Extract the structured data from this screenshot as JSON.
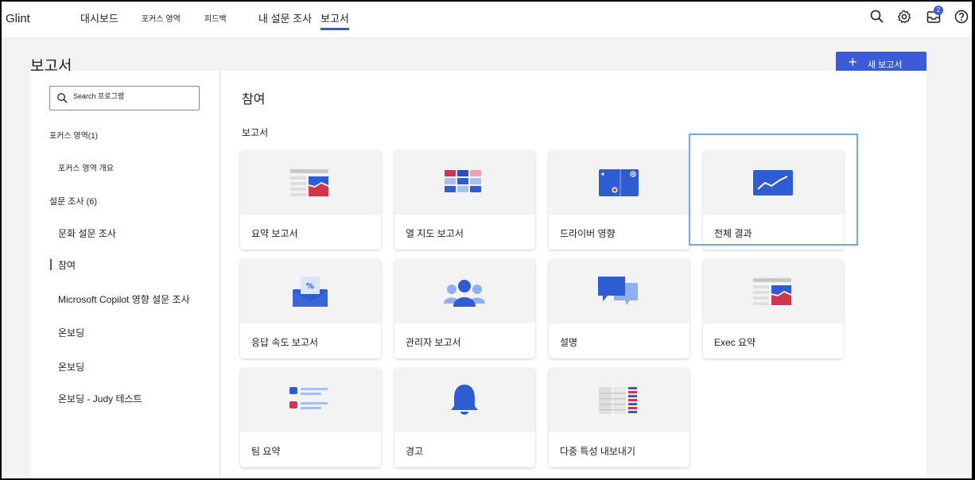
{
  "app": {
    "logo": "Glint"
  },
  "nav": {
    "tabs": [
      {
        "label": "대시보드"
      },
      {
        "label": "포커스 영역"
      },
      {
        "label": "피드백"
      },
      {
        "label": "내 설문 조사"
      },
      {
        "label": "보고서"
      }
    ],
    "notification_count": "2"
  },
  "page": {
    "title": "보고서",
    "new_report_label": "새 보고서"
  },
  "sidebar": {
    "search_placeholder": "Search 프로그램",
    "focus_section": "포커스 영역(1)",
    "focus_items": [
      {
        "label": "포커스 영역 개요"
      }
    ],
    "survey_section": "설문 조사 (6)",
    "survey_items": [
      {
        "label": "문화 설문 조사"
      },
      {
        "label": "참여"
      },
      {
        "label": "Microsoft Copilot 영향 설문 조사"
      },
      {
        "label": "온보딩"
      },
      {
        "label": "온보딩"
      },
      {
        "label": "온보딩 - Judy 테스트"
      }
    ]
  },
  "main": {
    "title": "참여",
    "reports_label": "보고서",
    "cards": [
      {
        "label": "요약 보고서",
        "icon": "summary-report-icon"
      },
      {
        "label": "열 지도 보고서",
        "icon": "heatmap-icon"
      },
      {
        "label": "드라이버 영향",
        "icon": "driver-impact-icon"
      },
      {
        "label": "전체 결과",
        "icon": "trend-line-icon"
      },
      {
        "label": "응답 속도 보고서",
        "icon": "response-rate-icon"
      },
      {
        "label": "관리자 보고서",
        "icon": "manager-group-icon"
      },
      {
        "label": "설명",
        "icon": "comments-icon"
      },
      {
        "label": "Exec 요약",
        "icon": "exec-summary-icon"
      },
      {
        "label": "팀 요약",
        "icon": "team-summary-icon"
      },
      {
        "label": "경고",
        "icon": "alert-bell-icon"
      },
      {
        "label": "다중 특성 내보내기",
        "icon": "multi-attribute-export-icon"
      }
    ]
  },
  "colors": {
    "accent": "#3b5bd8",
    "highlight": "#74a7e0",
    "red": "#d0364f"
  }
}
